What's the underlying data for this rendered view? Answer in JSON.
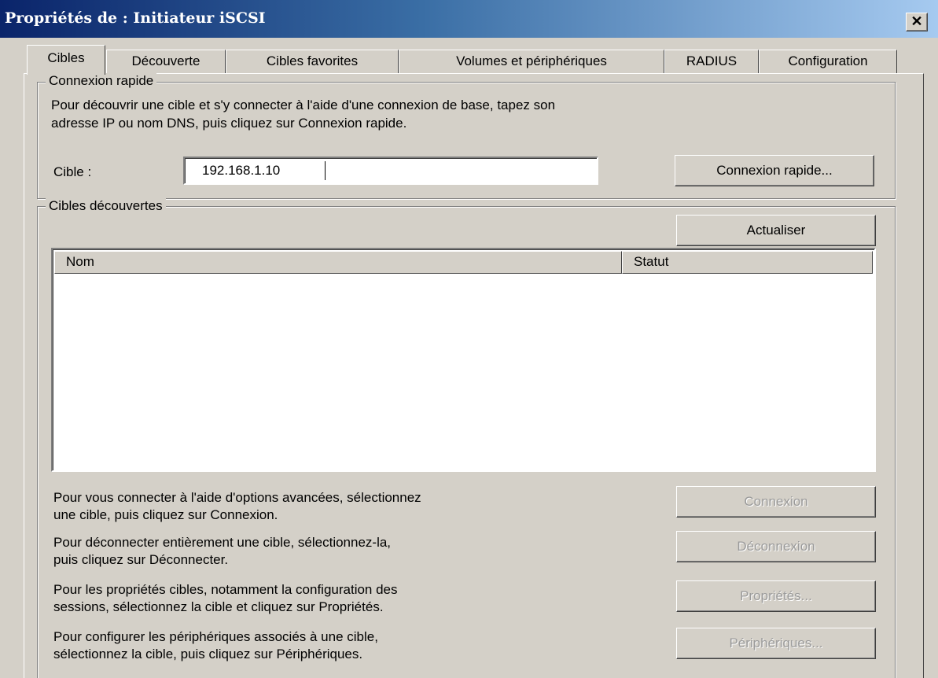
{
  "window": {
    "title": "Propriétés de : Initiateur iSCSI",
    "close_glyph": "✕"
  },
  "tabs": [
    {
      "label": "Cibles",
      "active": true
    },
    {
      "label": "Découverte",
      "active": false
    },
    {
      "label": "Cibles favorites",
      "active": false
    },
    {
      "label": "Volumes et périphériques",
      "active": false
    },
    {
      "label": "RADIUS",
      "active": false
    },
    {
      "label": "Configuration",
      "active": false
    }
  ],
  "quick_connect": {
    "legend": "Connexion rapide",
    "description_line1": "Pour découvrir une cible et s'y connecter à l'aide d'une connexion de base, tapez son",
    "description_line2": "adresse IP ou nom DNS, puis cliquez sur Connexion rapide.",
    "target_label": "Cible :",
    "target_value": "192.168.1.10",
    "button_label": "Connexion rapide..."
  },
  "discovered": {
    "legend": "Cibles découvertes",
    "refresh_label": "Actualiser",
    "columns": [
      "Nom",
      "Statut"
    ],
    "rows": []
  },
  "actions": [
    {
      "line1": "Pour vous connecter à l'aide d'options avancées, sélectionnez",
      "line2": "une cible, puis cliquez sur Connexion.",
      "button": "Connexion",
      "enabled": false
    },
    {
      "line1": "Pour déconnecter entièrement une cible, sélectionnez-la,",
      "line2": "puis cliquez sur Déconnecter.",
      "button": "Déconnexion",
      "enabled": false
    },
    {
      "line1": "Pour les propriétés cibles, notamment la configuration des",
      "line2": "sessions, sélectionnez la cible et cliquez sur Propriétés.",
      "button": "Propriétés...",
      "enabled": false
    },
    {
      "line1": "Pour configurer les périphériques associés à une cible,",
      "line2": "sélectionnez la cible, puis cliquez sur Périphériques.",
      "button": "Périphériques...",
      "enabled": false
    }
  ],
  "colors": {
    "face": "#d4d0c8",
    "title_start": "#0a246a",
    "title_end": "#a6caf0",
    "disabled_text": "#9a9a9a"
  }
}
